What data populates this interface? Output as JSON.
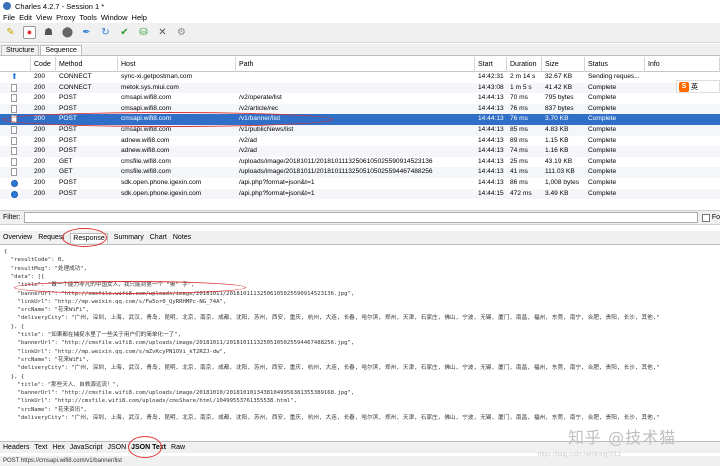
{
  "window": {
    "title": "Charles 4.2.7 - Session 1 *"
  },
  "menu": [
    "File",
    "Edit",
    "View",
    "Proxy",
    "Tools",
    "Window",
    "Help"
  ],
  "toolbar": [
    {
      "name": "broom-icon",
      "glyph": "✎"
    },
    {
      "name": "record-icon",
      "glyph": "●"
    },
    {
      "name": "turtle-icon",
      "glyph": "☗"
    },
    {
      "name": "stop-icon",
      "glyph": "⬤"
    },
    {
      "name": "pen-icon",
      "glyph": "✒"
    },
    {
      "name": "refresh-icon",
      "glyph": "↻"
    },
    {
      "name": "check-icon",
      "glyph": "✔"
    },
    {
      "name": "basket-icon",
      "glyph": "⛁"
    },
    {
      "name": "tools-icon",
      "glyph": "✕"
    },
    {
      "name": "gear-icon",
      "glyph": "⚙"
    }
  ],
  "view_tabs": [
    "Structure",
    "Sequence"
  ],
  "columns": [
    "",
    "Code",
    "Method",
    "Host",
    "Path",
    "Start",
    "Duration",
    "Size",
    "Status",
    "Info"
  ],
  "rows": [
    {
      "icon": "up",
      "code": "200",
      "method": "CONNECT",
      "host": "sync-xi.getpostman.com",
      "path": "",
      "start": "14:42:31",
      "duration": "2 m 14 s",
      "size": "32.67 KB",
      "status": "Sending reques..."
    },
    {
      "icon": "doc",
      "code": "200",
      "method": "CONNECT",
      "host": "metok.sys.miui.com",
      "path": "",
      "start": "14:43:08",
      "duration": "1 m 5 s",
      "size": "41.42 KB",
      "status": "Complete"
    },
    {
      "icon": "doc",
      "code": "200",
      "method": "POST",
      "host": "cmsapi.wifi8.com",
      "path": "/v2/operate/list",
      "start": "14:44:13",
      "duration": "70 ms",
      "size": "795 bytes",
      "status": "Complete"
    },
    {
      "icon": "doc",
      "code": "200",
      "method": "POST",
      "host": "cmsapi.wifi8.com",
      "path": "/v2/article/rec",
      "start": "14:44:13",
      "duration": "76 ms",
      "size": "837 bytes",
      "status": "Complete"
    },
    {
      "icon": "doc",
      "code": "200",
      "method": "POST",
      "host": "cmsapi.wifi8.com",
      "path": "/v1/banner/list",
      "start": "14:44:13",
      "duration": "76 ms",
      "size": "3.70 KB",
      "status": "Complete",
      "selected": true
    },
    {
      "icon": "doc",
      "code": "200",
      "method": "POST",
      "host": "cmsapi.wifi8.com",
      "path": "/v1/publicNews/list",
      "start": "14:44:13",
      "duration": "85 ms",
      "size": "4.83 KB",
      "status": "Complete"
    },
    {
      "icon": "doc",
      "code": "200",
      "method": "POST",
      "host": "adnew.wifi8.com",
      "path": "/v2/ad",
      "start": "14:44:13",
      "duration": "89 ms",
      "size": "1.15 KB",
      "status": "Complete"
    },
    {
      "icon": "doc",
      "code": "200",
      "method": "POST",
      "host": "adnew.wifi8.com",
      "path": "/v2/ad",
      "start": "14:44:13",
      "duration": "74 ms",
      "size": "1.16 KB",
      "status": "Complete"
    },
    {
      "icon": "doc",
      "code": "200",
      "method": "GET",
      "host": "cmsfile.wifi8.com",
      "path": "/uploads/image/20181011/20181011132506105025590914523136",
      "start": "14:44:13",
      "duration": "25 ms",
      "size": "43.19 KB",
      "status": "Complete"
    },
    {
      "icon": "doc",
      "code": "200",
      "method": "GET",
      "host": "cmsfile.wifi8.com",
      "path": "/uploads/image/20181011/20181011132505105025594467488256",
      "start": "14:44:13",
      "duration": "41 ms",
      "size": "111.03 KB",
      "status": "Complete"
    },
    {
      "icon": "circle",
      "code": "200",
      "method": "POST",
      "host": "sdk.open.phone.igexin.com",
      "path": "/api.php?format=json&t=1",
      "start": "14:44:13",
      "duration": "86 ms",
      "size": "1,008 bytes",
      "status": "Complete"
    },
    {
      "icon": "circle",
      "code": "200",
      "method": "POST",
      "host": "sdk.open.phone.igexin.com",
      "path": "/api.php?format=json&t=1",
      "start": "14:44:15",
      "duration": "472 ms",
      "size": "3.49 KB",
      "status": "Complete"
    }
  ],
  "filter": {
    "label": "Filter:",
    "value": "",
    "checkbox_label": "Fo"
  },
  "detail_tabs": [
    "Overview",
    "Request",
    "Response",
    "Summary",
    "Chart",
    "Notes"
  ],
  "active_detail_tab": "Response",
  "json_lines": [
    "{",
    "  \"resultCode\": 0,",
    "  \"resultMsg\": \"处理成功\",",
    "  \"data\": [{",
    "    \"title\": \"做一个能力非凡的中国女人，我只能到第一个 “奥” 字\",",
    "    \"bannerUrl\": \"http://cmsfile.wifi8.com/uploads/image/20181011/20181011132506105025590914523136.jpg\",",
    "    \"linkUrl\": \"http://mp.weixin.qq.com/s/Fw5or0_QyRRHMPc-NG_74A\",",
    "    \"srcName\": \"花来WiFi\",",
    "    \"deliveryCity\": \"广州, 深圳, 上海, 武汉, 青岛, 昆明, 北京, 南京, 成都, 沈阳, 苏州, 西安, 重庆, 杭州, 大连, 长春, 哈尔滨, 郑州, 天津, 石家庄, 佛山, 宁波, 无锡, 厦门, 南昌, 福州, 东莞, 南宁, 合肥, 贵阳, 长沙, 其他,\"",
    "  }, {",
    "    \"title\": \"如果都在捕捉水里了一些关于用户们的简单化一了\",",
    "    \"bannerUrl\": \"http://cmsfile.wifi8.com/uploads/image/20181011/20181011132505105025594467488256.jpg\",",
    "    \"linkUrl\": \"http://mp.weixin.qq.com/s/mZvKcyPN1OVi_kT2RZJ-dw\",",
    "    \"srcName\": \"花来WiFi\",",
    "    \"deliveryCity\": \"广州, 深圳, 上海, 武汉, 青岛, 昆明, 北京, 南京, 成都, 沈阳, 苏州, 西安, 重庆, 杭州, 大连, 长春, 哈尔滨, 郑州, 天津, 石家庄, 佛山, 宁波, 无锡, 厦门, 南昌, 福州, 东莞, 南宁, 合肥, 贵阳, 长沙, 其他,\"",
    "  }, {",
    "    \"title\": \"那些天人、自救源远流！\",",
    "    \"bannerUrl\": \"http://cmsfile.wifi8.com/uploads/image/20181010/20181010134381049956381355389168.jpg\",",
    "    \"linkUrl\": \"http://cmsfile.wifi8.com/uploads/cmsShare/html/10499553761355538.html\",",
    "    \"srcName\": \"花来资讯\",",
    "    \"deliveryCity\": \"广州, 深圳, 上海, 武汉, 青岛, 昆明, 北京, 南京, 成都, 沈阳, 苏州, 西安, 重庆, 杭州, 大连, 长春, 哈尔滨, 郑州, 天津, 石家庄, 佛山, 宁波, 无锡, 厦门, 南昌, 福州, 东莞, 南宁, 合肥, 贵阳, 长沙, 其他,\""
  ],
  "bottom_tabs": [
    "Headers",
    "Text",
    "Hex",
    "JavaScript",
    "JSON",
    "JSON Text",
    "Raw"
  ],
  "active_bottom_tab": "JSON Text",
  "status_text": "POST https://cmsapi.wifi8.com/v1/banner/list",
  "watermark": "知乎 @技术猫",
  "watermark_url": "https://blog.csdn.net/lining0013",
  "ime_label": "英"
}
